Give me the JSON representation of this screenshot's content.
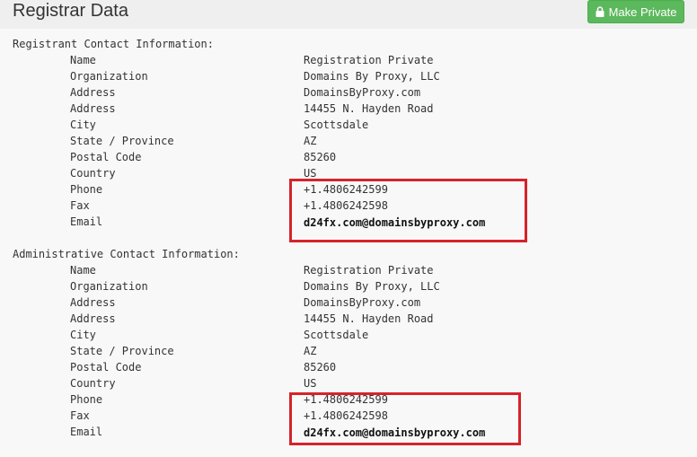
{
  "header": {
    "title": "Registrar Data",
    "make_private_label": "Make Private"
  },
  "registrant": {
    "title": "Registrant Contact Information:",
    "rows": [
      {
        "label": "Name",
        "value": "Registration Private"
      },
      {
        "label": "Organization",
        "value": "Domains By Proxy, LLC"
      },
      {
        "label": "Address",
        "value": "DomainsByProxy.com"
      },
      {
        "label": "Address",
        "value": "14455 N. Hayden Road"
      },
      {
        "label": "City",
        "value": "Scottsdale"
      },
      {
        "label": "State / Province",
        "value": "AZ"
      },
      {
        "label": "Postal Code",
        "value": "85260"
      },
      {
        "label": "Country",
        "value": "US"
      },
      {
        "label": "Phone",
        "value": "+1.4806242599"
      },
      {
        "label": "Fax",
        "value": "+1.4806242598"
      },
      {
        "label": "Email",
        "value": "d24fx.com@domainsbyproxy.com"
      }
    ]
  },
  "administrative": {
    "title": "Administrative Contact Information:",
    "rows": [
      {
        "label": "Name",
        "value": "Registration Private"
      },
      {
        "label": "Organization",
        "value": "Domains By Proxy, LLC"
      },
      {
        "label": "Address",
        "value": "DomainsByProxy.com"
      },
      {
        "label": "Address",
        "value": "14455 N. Hayden Road"
      },
      {
        "label": "City",
        "value": "Scottsdale"
      },
      {
        "label": "State / Province",
        "value": "AZ"
      },
      {
        "label": "Postal Code",
        "value": "85260"
      },
      {
        "label": "Country",
        "value": "US"
      },
      {
        "label": "Phone",
        "value": "+1.4806242599"
      },
      {
        "label": "Fax",
        "value": "+1.4806242598"
      },
      {
        "label": "Email",
        "value": "d24fx.com@domainsbyproxy.com"
      }
    ]
  },
  "colors": {
    "accent": "#5cb85c",
    "highlight": "#d6232b"
  }
}
